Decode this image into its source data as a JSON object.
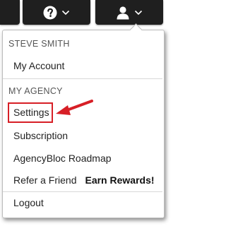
{
  "topbar": {
    "help_icon": "question-circle-icon",
    "user_icon": "user-icon",
    "chevron_icon": "chevron-down-icon"
  },
  "menu": {
    "user_name": "STEVE SMITH",
    "my_account": "My Account",
    "agency_header": "MY AGENCY",
    "settings": "Settings",
    "subscription": "Subscription",
    "roadmap": "AgencyBloc Roadmap",
    "refer_friend": "Refer a Friend",
    "earn_rewards": "Earn Rewards!",
    "logout": "Logout"
  },
  "colors": {
    "highlight": "#d71f26",
    "topbar": "#1f1f1f"
  }
}
